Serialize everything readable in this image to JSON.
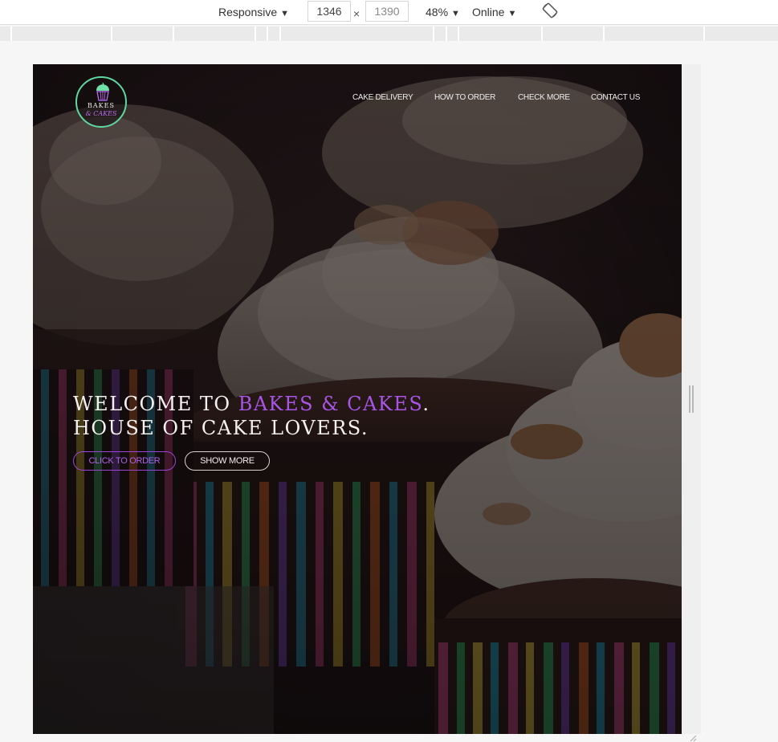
{
  "devtools": {
    "device": "Responsive",
    "width": "1346",
    "times": "×",
    "height": "1390",
    "zoom": "48%",
    "throttle": "Online",
    "arrow": "▼"
  },
  "site": {
    "logo_line1": "BAKES",
    "logo_line2": "& CAKES",
    "nav": [
      "CAKE DELIVERY",
      "HOW TO ORDER",
      "CHECK MORE",
      "CONTACT US"
    ],
    "hero": {
      "line1_prefix": "WELCOME TO ",
      "line1_brand": "BAKES & CAKES",
      "line1_suffix": ".",
      "line2": "HOUSE OF CAKE LOVERS."
    },
    "buttons": {
      "order": "CLICK TO ORDER",
      "more": "SHOW MORE"
    }
  },
  "colors": {
    "brand_purple": "#a855e6",
    "logo_ring": "#5fd6a0",
    "overlay": "#1f1617"
  }
}
